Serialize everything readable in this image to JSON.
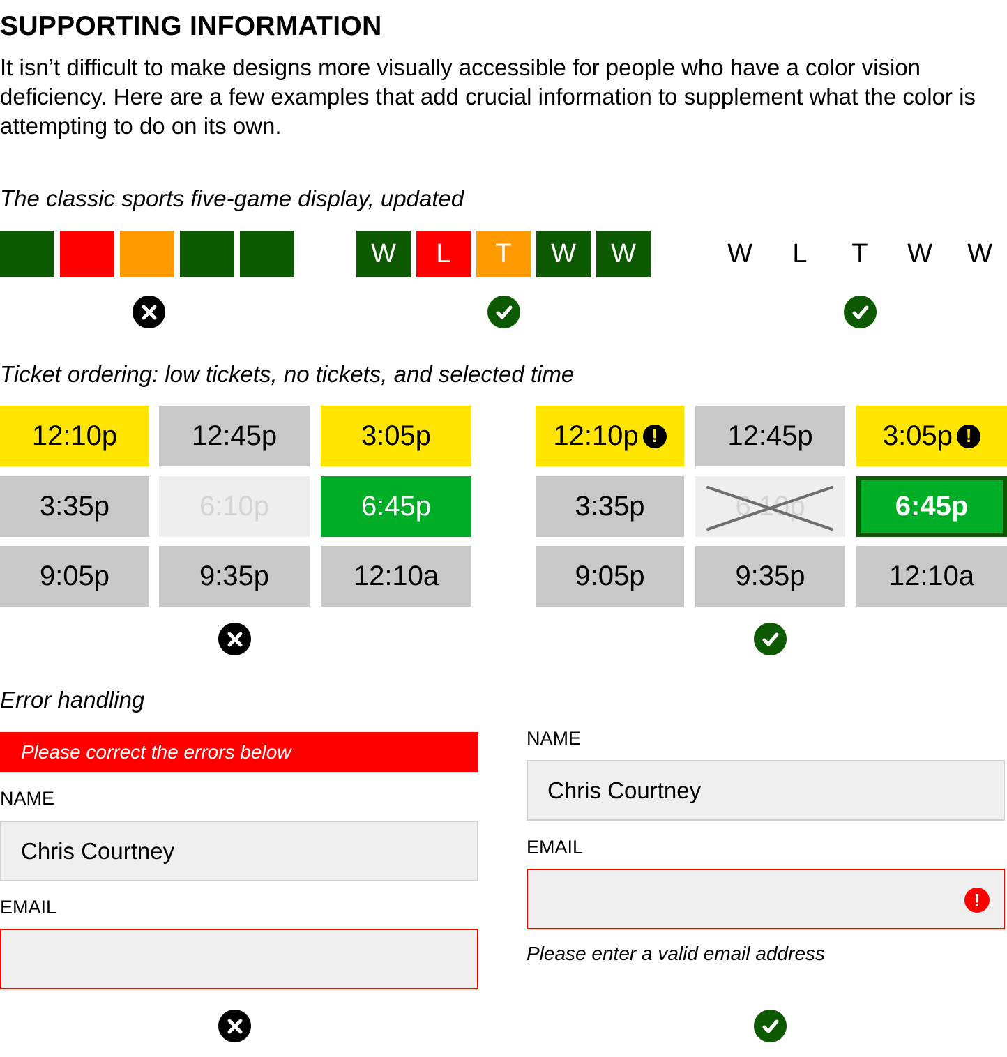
{
  "title": "SUPPORTING INFORMATION",
  "intro": "It isn’t difficult to make designs more visually accessible for people who have a color vision deficiency. Here are a few examples that add crucial information to supplement what the color is attempting to do on its own.",
  "colors": {
    "win": "#0e5a02",
    "loss": "#ff0000",
    "tie": "#ff9a00",
    "low": "#ffe500",
    "unavailable": "#eeeeee",
    "available": "#c8c8c8",
    "selected": "#00ad26",
    "error": "#ff0000",
    "good": "#0e5a02",
    "bad": "#000000"
  },
  "sports": {
    "subtitle": "The classic sports five-game display, updated",
    "results": [
      "W",
      "L",
      "T",
      "W",
      "W"
    ],
    "verdicts": [
      "x-circle-icon",
      "check-circle-icon",
      "check-circle-icon"
    ]
  },
  "tickets": {
    "subtitle": "Ticket ordering: low tickets, no tickets, and selected time",
    "times": [
      {
        "time": "12:10p",
        "status": "low"
      },
      {
        "time": "12:45p",
        "status": "available"
      },
      {
        "time": "3:05p",
        "status": "low"
      },
      {
        "time": "3:35p",
        "status": "available"
      },
      {
        "time": "6:10p",
        "status": "sold-out"
      },
      {
        "time": "6:45p",
        "status": "selected"
      },
      {
        "time": "9:05p",
        "status": "available"
      },
      {
        "time": "9:35p",
        "status": "available"
      },
      {
        "time": "12:10a",
        "status": "available"
      }
    ],
    "low_icon": "!"
  },
  "errors": {
    "subtitle": "Error handling",
    "banner": "Please correct the errors below",
    "name_label": "NAME",
    "name_value": "Chris Courtney",
    "email_label": "EMAIL",
    "email_value": "",
    "email_error": "Please enter a valid email address"
  }
}
